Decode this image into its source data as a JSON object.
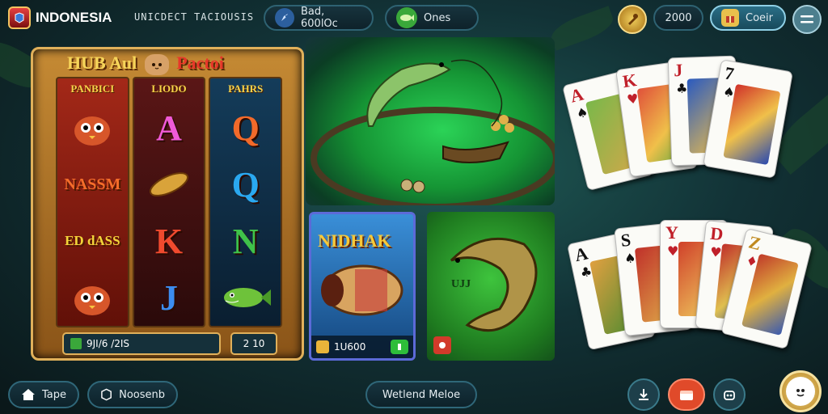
{
  "header": {
    "brand": "INDONESIA",
    "subtitle": "UNICDECT TACIOUSIS",
    "pill_a": "Bad, 600lOc",
    "pill_b": "Ones",
    "coins": "2000",
    "cta": "Coeir"
  },
  "slot": {
    "title_a": "HUB Aul",
    "title_b": "Pactoi",
    "reels": [
      {
        "head": "PANBICI",
        "symbols": [
          "",
          "NASSM",
          "ED dASS",
          ""
        ]
      },
      {
        "head": "LIODO",
        "symbols": [
          "A",
          "",
          "K",
          "J"
        ]
      },
      {
        "head": "PAHRS",
        "symbols": [
          "Q",
          "Q",
          "N",
          ""
        ]
      }
    ],
    "footer_left": "9JI/6 /2IS",
    "footer_right": "2 10"
  },
  "tiles": {
    "a": {
      "title": "NIDHAK",
      "footer": "1U600"
    },
    "b": {
      "mark": "UJJ"
    }
  },
  "cards": {
    "top": [
      "A",
      "K",
      "J",
      "7"
    ],
    "bottom": [
      "A",
      "S",
      "Y",
      "D",
      "Z"
    ]
  },
  "bottom": {
    "home": "Tape",
    "mode": "Noosenb",
    "center": "Wetlend Meloe"
  },
  "colors": {
    "accent": "#2e6272",
    "gold": "#e0b05a",
    "red": "#e8362a"
  }
}
